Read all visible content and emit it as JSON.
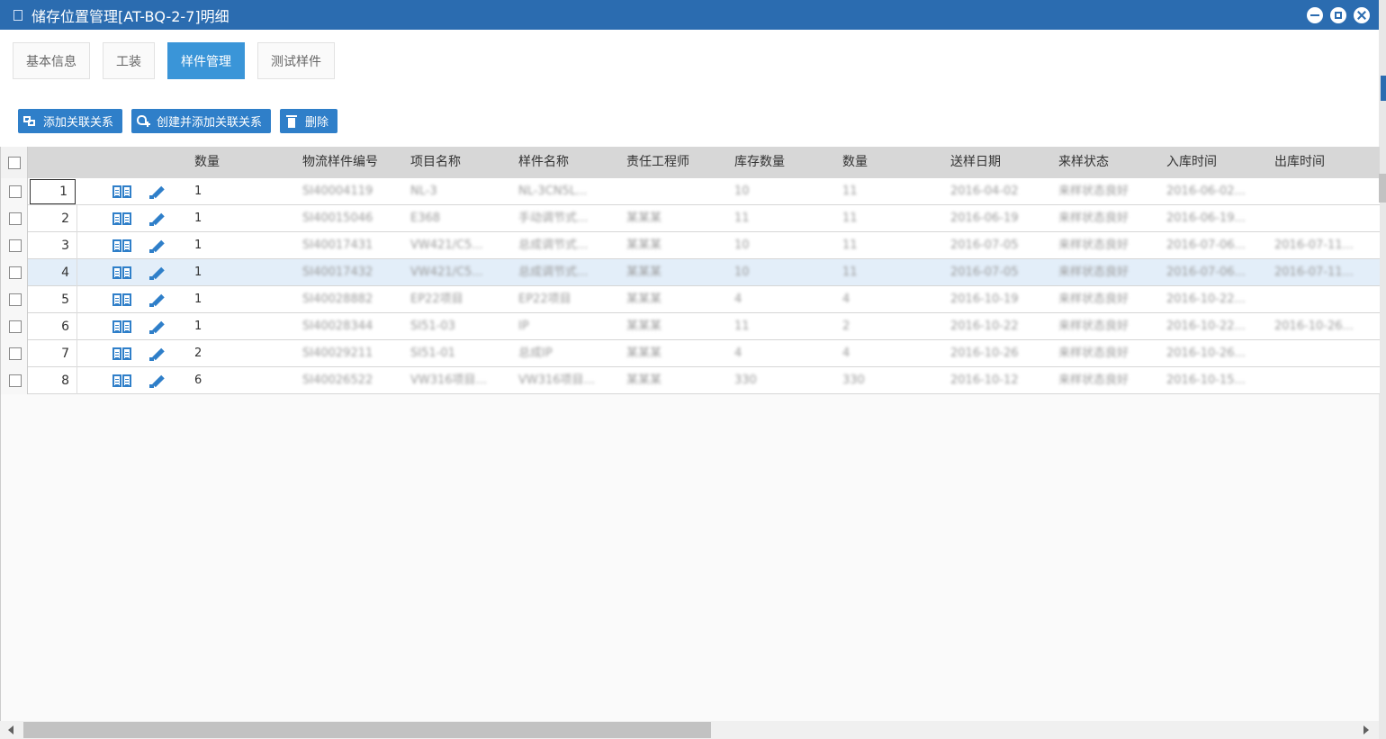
{
  "window": {
    "title": "储存位置管理[AT-BQ-2-7]明细"
  },
  "tabs": [
    {
      "label": "基本信息",
      "active": false
    },
    {
      "label": "工装",
      "active": false
    },
    {
      "label": "样件管理",
      "active": true
    },
    {
      "label": "测试样件",
      "active": false
    }
  ],
  "toolbar": {
    "add_relation": "添加关联关系",
    "create_add_relation": "创建并添加关联关系",
    "delete": "删除"
  },
  "grid": {
    "columns": [
      "数量",
      "物流样件编号",
      "项目名称",
      "样件名称",
      "责任工程师",
      "库存数量",
      "数量",
      "送样日期",
      "来样状态",
      "入库时间",
      "出库时间"
    ],
    "rows": [
      {
        "index": "1",
        "qty": "1",
        "logistics_no": "SI40004119",
        "project": "NL-3",
        "sample": "NL-3CN5L...",
        "engineer": "",
        "stock": "10",
        "count": "11",
        "send_date": "2016-04-02",
        "status": "来样状态良好",
        "in_time": "2016-06-02...",
        "out_time": ""
      },
      {
        "index": "2",
        "qty": "1",
        "logistics_no": "SI40015046",
        "project": "E368",
        "sample": "手动调节式...",
        "engineer": "某某某",
        "stock": "11",
        "count": "11",
        "send_date": "2016-06-19",
        "status": "来样状态良好",
        "in_time": "2016-06-19...",
        "out_time": ""
      },
      {
        "index": "3",
        "qty": "1",
        "logistics_no": "SI40017431",
        "project": "VW421/C5...",
        "sample": "总成调节式...",
        "engineer": "某某某",
        "stock": "10",
        "count": "11",
        "send_date": "2016-07-05",
        "status": "来样状态良好",
        "in_time": "2016-07-06...",
        "out_time": "2016-07-11..."
      },
      {
        "index": "4",
        "qty": "1",
        "logistics_no": "SI40017432",
        "project": "VW421/C5...",
        "sample": "总成调节式...",
        "engineer": "某某某",
        "stock": "10",
        "count": "11",
        "send_date": "2016-07-05",
        "status": "来样状态良好",
        "in_time": "2016-07-06...",
        "out_time": "2016-07-11..."
      },
      {
        "index": "5",
        "qty": "1",
        "logistics_no": "SI40028882",
        "project": "EP22项目",
        "sample": "EP22项目",
        "engineer": "某某某",
        "stock": "4",
        "count": "4",
        "send_date": "2016-10-19",
        "status": "来样状态良好",
        "in_time": "2016-10-22...",
        "out_time": ""
      },
      {
        "index": "6",
        "qty": "1",
        "logistics_no": "SI40028344",
        "project": "SI51-03",
        "sample": "IP",
        "engineer": "某某某",
        "stock": "11",
        "count": "2",
        "send_date": "2016-10-22",
        "status": "来样状态良好",
        "in_time": "2016-10-22...",
        "out_time": "2016-10-26..."
      },
      {
        "index": "7",
        "qty": "2",
        "logistics_no": "SI40029211",
        "project": "SI51-01",
        "sample": "总成IP",
        "engineer": "某某某",
        "stock": "4",
        "count": "4",
        "send_date": "2016-10-26",
        "status": "来样状态良好",
        "in_time": "2016-10-26...",
        "out_time": ""
      },
      {
        "index": "8",
        "qty": "6",
        "logistics_no": "SI40026522",
        "project": "VW316项目...",
        "sample": "VW316项目...",
        "engineer": "某某某",
        "stock": "330",
        "count": "330",
        "send_date": "2016-10-12",
        "status": "来样状态良好",
        "in_time": "2016-10-15...",
        "out_time": ""
      }
    ]
  },
  "colors": {
    "titlebar": "#2b6cb0",
    "accent": "#3a95d8",
    "button": "#2f7fc9",
    "selected_row": "#e3eef9"
  }
}
